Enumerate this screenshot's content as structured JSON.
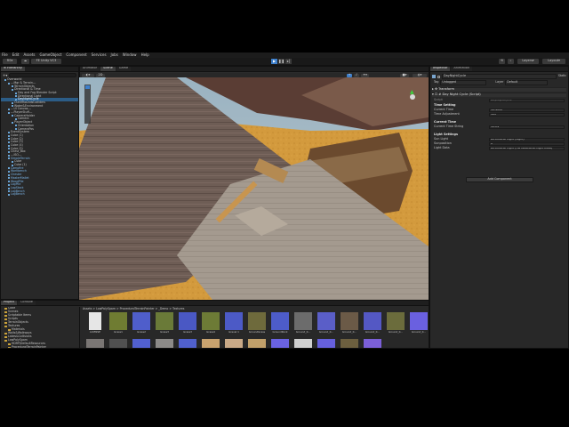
{
  "menu": [
    "File",
    "Edit",
    "Assets",
    "GameObject",
    "Component",
    "Services",
    "Jobs",
    "Window",
    "Help"
  ],
  "toolbar": {
    "account": "RS",
    "cloud": "FE Unity VC3",
    "layers": "Layers",
    "layout": "Layout"
  },
  "hierarchy": {
    "tab": "Hierarchy",
    "rows": [
      {
        "label": "Overworld",
        "indent": 1,
        "type": "scene"
      },
      {
        "label": "---Mgr & Terrain---",
        "indent": 2,
        "type": "obj"
      },
      {
        "label": "TerrainObjects",
        "indent": 3,
        "type": "obj"
      },
      {
        "label": "Directional & Time",
        "indent": 3,
        "type": "obj"
      },
      {
        "label": "Day and Fog Blender Script",
        "indent": 4,
        "type": "obj"
      },
      {
        "label": "Directional Light",
        "indent": 4,
        "type": "obj"
      },
      {
        "label": "DayNightCycle",
        "indent": 4,
        "type": "sel"
      },
      {
        "label": "OutOfBoundsColliders",
        "indent": 3,
        "type": "obj"
      },
      {
        "label": "Water&Environment",
        "indent": 3,
        "type": "obj"
      },
      {
        "label": "---UI Canvas---",
        "indent": 2,
        "type": "obj"
      },
      {
        "label": "---PlayerStuff---",
        "indent": 2,
        "type": "obj"
      },
      {
        "label": "CameraHolder",
        "indent": 3,
        "type": "obj"
      },
      {
        "label": "Camera",
        "indent": 4,
        "type": "obj"
      },
      {
        "label": "PlayerObject",
        "indent": 3,
        "type": "obj"
      },
      {
        "label": "Orientation",
        "indent": 4,
        "type": "obj"
      },
      {
        "label": "CameraPos",
        "indent": 4,
        "type": "obj"
      },
      {
        "label": "EventSystem",
        "indent": 2,
        "type": "obj"
      },
      {
        "label": "Cube (1)",
        "indent": 2,
        "type": "obj"
      },
      {
        "label": "Cube (2)",
        "indent": 2,
        "type": "obj"
      },
      {
        "label": "Cube (3)",
        "indent": 2,
        "type": "obj"
      },
      {
        "label": "Cube (4)",
        "indent": 2,
        "type": "obj"
      },
      {
        "label": "Cube (5)",
        "indent": 2,
        "type": "obj"
      },
      {
        "label": "Chest_Box",
        "indent": 2,
        "type": "obj"
      },
      {
        "label": "---ISO---",
        "indent": 2,
        "type": "obj"
      },
      {
        "label": "SimpleTerrain",
        "indent": 2,
        "type": "blue"
      },
      {
        "label": "Cube",
        "indent": 3,
        "type": "obj"
      },
      {
        "label": "Cube (1)",
        "indent": 3,
        "type": "obj"
      },
      {
        "label": "Campfire",
        "indent": 2,
        "type": "blue"
      },
      {
        "label": "Workbench",
        "indent": 2,
        "type": "blue"
      },
      {
        "label": "Chester",
        "indent": 2,
        "type": "blue"
      },
      {
        "label": "MasterMallet",
        "indent": 2,
        "type": "blue"
      },
      {
        "label": "WoodPile",
        "indent": 2,
        "type": "blue"
      },
      {
        "label": "LogPile",
        "indent": 2,
        "type": "blue"
      },
      {
        "label": "LogStack",
        "indent": 2,
        "type": "blue"
      },
      {
        "label": "LogBench",
        "indent": 2,
        "type": "blue"
      },
      {
        "label": "LogBench",
        "indent": 2,
        "type": "blue"
      }
    ]
  },
  "scene_tabs": [
    "Animator",
    "Scene",
    "Game"
  ],
  "inspector": {
    "tabs": [
      "Inspector",
      "Animation"
    ],
    "object_name": "DayNightCycle",
    "static_label": "Static",
    "tag_label": "Tag",
    "tag_value": "Untagged",
    "layer_label": "Layer",
    "layer_value": "Default",
    "script_label": "Script",
    "script_value": "DayNightCycle",
    "transform": "Transform",
    "component": "Day Night Cycle (Script)",
    "sections": [
      {
        "header": "Time Setting",
        "rows": [
          {
            "label": "Current Time",
            "value": "10.4000"
          },
          {
            "label": "Time Adjustment",
            "value": "105"
          }
        ]
      },
      {
        "header": "Current Time",
        "rows": [
          {
            "label": "Current Time String",
            "value": "10:24"
          }
        ]
      },
      {
        "header": "Light Settings",
        "rows": [
          {
            "label": "Sun Light",
            "value": "Directional Light (Light)"
          },
          {
            "label": "Sunposition",
            "value": "0"
          },
          {
            "label": "Light Data",
            "value": "Directional Light (HD Additional Light Data)"
          }
        ]
      }
    ],
    "add_component": "Add Component"
  },
  "project": {
    "tabs": [
      "Project",
      "Console"
    ],
    "breadcrumb": "Assets > LowPolySpam > ProceduralTerrainPainter > _Demo > Textures",
    "tree": [
      "Code",
      "Scenes",
      "Scriptable Items",
      "Scripts",
      "TerrainObjects",
      "Textures",
      "Materials",
      "Walls&Walkways",
      "Lakes&Collisions",
      "LowPolySpam",
      "HDRP/DefaultResources",
      "ProceduralTerrainPainter",
      "_Demo",
      "Layers",
      "TerrainData",
      "Textures",
      "Editor",
      "Runtime"
    ],
    "assets": [
      {
        "name": "LICENSE",
        "color": "#e6e6e6"
      },
      {
        "name": "Grass1",
        "color": "#6f7c32"
      },
      {
        "name": "Grass2",
        "color": "#4f5ecb"
      },
      {
        "name": "Grass3",
        "color": "#6a7a38"
      },
      {
        "name": "Grass3",
        "color": "#4a58c4"
      },
      {
        "name": "Grass4",
        "color": "#6d7b36"
      },
      {
        "name": "Gravel 1",
        "color": "#4c5ac6"
      },
      {
        "name": "GroundGrass",
        "color": "#6e6a3c"
      },
      {
        "name": "GroundRock",
        "color": "#4d5cc9"
      },
      {
        "name": "Ground_0...",
        "color": "#6c6c6c"
      },
      {
        "name": "Ground_0...",
        "color": "#5a5ec8"
      },
      {
        "name": "Ground_0...",
        "color": "#6b5a47"
      },
      {
        "name": "Ground_0...",
        "color": "#5458c4"
      },
      {
        "name": "Ground_0...",
        "color": "#6b6c3c"
      },
      {
        "name": "Ground_0...",
        "color": "#6a60e0"
      },
      {
        "name": "Rocks",
        "color": "#7a7674"
      },
      {
        "name": "Rock_02",
        "color": "#505050"
      },
      {
        "name": "Rock_02",
        "color": "#5160cf"
      },
      {
        "name": "RockyPath",
        "color": "#8c8a88"
      },
      {
        "name": "RockyPath",
        "color": "#5060cc"
      },
      {
        "name": "Sand1",
        "color": "#c8a26e"
      },
      {
        "name": "Sand1",
        "color": "#c9a987"
      },
      {
        "name": "Sand_Dun...",
        "color": "#c1a06a"
      },
      {
        "name": "Sand_Dun...",
        "color": "#6a62e2"
      },
      {
        "name": "Snow_001",
        "color": "#cfcfcf"
      },
      {
        "name": "Snow_001",
        "color": "#6660dd"
      },
      {
        "name": "Wetland",
        "color": "#6c5f3f"
      },
      {
        "name": "Wetland1",
        "color": "#7b5fd8"
      }
    ]
  }
}
